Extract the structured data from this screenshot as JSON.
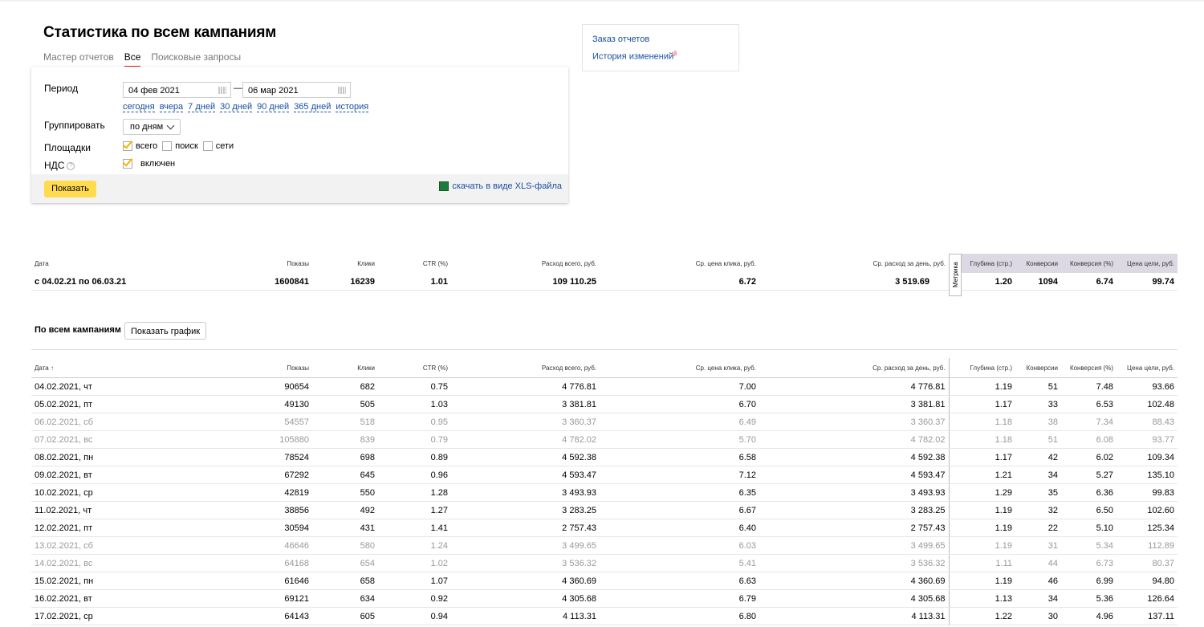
{
  "page": {
    "title": "Статистика по всем кампаниям",
    "tabs": [
      "Мастер отчетов",
      "Все",
      "Поисковые запросы"
    ],
    "active_tab": "Все"
  },
  "filters": {
    "period_label": "Период",
    "date_from": "04 фев 2021",
    "date_to": "06 мар 2021",
    "dash": "—",
    "quick_ranges": [
      "сегодня",
      "вчера",
      "7 дней",
      "30 дней",
      "90 дней",
      "365 дней",
      "история"
    ],
    "group_label": "Группировать",
    "group_value": "по дням",
    "platforms_label": "Площадки",
    "platforms": {
      "all": "всего",
      "search": "поиск",
      "networks": "сети"
    },
    "vat_label": "НДС",
    "vat_value": "включен",
    "show_button": "Показать",
    "xls_link": "скачать в виде XLS-файла"
  },
  "side_links": {
    "order_reports": "Заказ отчетов",
    "history": "История изменений",
    "history_mark": "β"
  },
  "columns": [
    "Дата",
    "Показы",
    "Клики",
    "CTR (%)",
    "Расход всего, руб.",
    "Ср. цена клика, руб.",
    "Ср. расход за день, руб.",
    "Глубина (стр.)",
    "Конверсии",
    "Конверсия (%)",
    "Цена цели, руб."
  ],
  "metrika_label": "Метрика",
  "sort_arrow": "↑",
  "summary": [
    "с 04.02.21 по 06.03.21",
    "1600841",
    "16239",
    "1.01",
    "109 110.25",
    "6.72",
    "3 519.69",
    "1.20",
    "1094",
    "6.74",
    "99.74"
  ],
  "campaigns": {
    "title": "По всем кампаниям",
    "graph_button": "Показать график"
  },
  "rows": [
    {
      "cells": [
        "04.02.2021, чт",
        "90654",
        "682",
        "0.75",
        "4 776.81",
        "7.00",
        "4 776.81",
        "1.19",
        "51",
        "7.48",
        "93.66"
      ],
      "weekend": false
    },
    {
      "cells": [
        "05.02.2021, пт",
        "49130",
        "505",
        "1.03",
        "3 381.81",
        "6.70",
        "3 381.81",
        "1.17",
        "33",
        "6.53",
        "102.48"
      ],
      "weekend": false
    },
    {
      "cells": [
        "06.02.2021, сб",
        "54557",
        "518",
        "0.95",
        "3 360.37",
        "6.49",
        "3 360.37",
        "1.18",
        "38",
        "7.34",
        "88.43"
      ],
      "weekend": true
    },
    {
      "cells": [
        "07.02.2021, вс",
        "105880",
        "839",
        "0.79",
        "4 782.02",
        "5.70",
        "4 782.02",
        "1.18",
        "51",
        "6.08",
        "93.77"
      ],
      "weekend": true
    },
    {
      "cells": [
        "08.02.2021, пн",
        "78524",
        "698",
        "0.89",
        "4 592.38",
        "6.58",
        "4 592.38",
        "1.17",
        "42",
        "6.02",
        "109.34"
      ],
      "weekend": false
    },
    {
      "cells": [
        "09.02.2021, вт",
        "67292",
        "645",
        "0.96",
        "4 593.47",
        "7.12",
        "4 593.47",
        "1.21",
        "34",
        "5.27",
        "135.10"
      ],
      "weekend": false
    },
    {
      "cells": [
        "10.02.2021, ср",
        "42819",
        "550",
        "1.28",
        "3 493.93",
        "6.35",
        "3 493.93",
        "1.29",
        "35",
        "6.36",
        "99.83"
      ],
      "weekend": false
    },
    {
      "cells": [
        "11.02.2021, чт",
        "38856",
        "492",
        "1.27",
        "3 283.25",
        "6.67",
        "3 283.25",
        "1.19",
        "32",
        "6.50",
        "102.60"
      ],
      "weekend": false
    },
    {
      "cells": [
        "12.02.2021, пт",
        "30594",
        "431",
        "1.41",
        "2 757.43",
        "6.40",
        "2 757.43",
        "1.19",
        "22",
        "5.10",
        "125.34"
      ],
      "weekend": false
    },
    {
      "cells": [
        "13.02.2021, сб",
        "46646",
        "580",
        "1.24",
        "3 499.65",
        "6.03",
        "3 499.65",
        "1.19",
        "31",
        "5.34",
        "112.89"
      ],
      "weekend": true
    },
    {
      "cells": [
        "14.02.2021, вс",
        "64168",
        "654",
        "1.02",
        "3 536.32",
        "5.41",
        "3 536.32",
        "1.11",
        "44",
        "6.73",
        "80.37"
      ],
      "weekend": true
    },
    {
      "cells": [
        "15.02.2021, пн",
        "61646",
        "658",
        "1.07",
        "4 360.69",
        "6.63",
        "4 360.69",
        "1.19",
        "46",
        "6.99",
        "94.80"
      ],
      "weekend": false
    },
    {
      "cells": [
        "16.02.2021, вт",
        "69121",
        "634",
        "0.92",
        "4 305.68",
        "6.79",
        "4 305.68",
        "1.13",
        "34",
        "5.36",
        "126.64"
      ],
      "weekend": false
    },
    {
      "cells": [
        "17.02.2021, ср",
        "64143",
        "605",
        "0.94",
        "4 113.31",
        "6.80",
        "4 113.31",
        "1.22",
        "30",
        "4.96",
        "137.11"
      ],
      "weekend": false
    }
  ]
}
